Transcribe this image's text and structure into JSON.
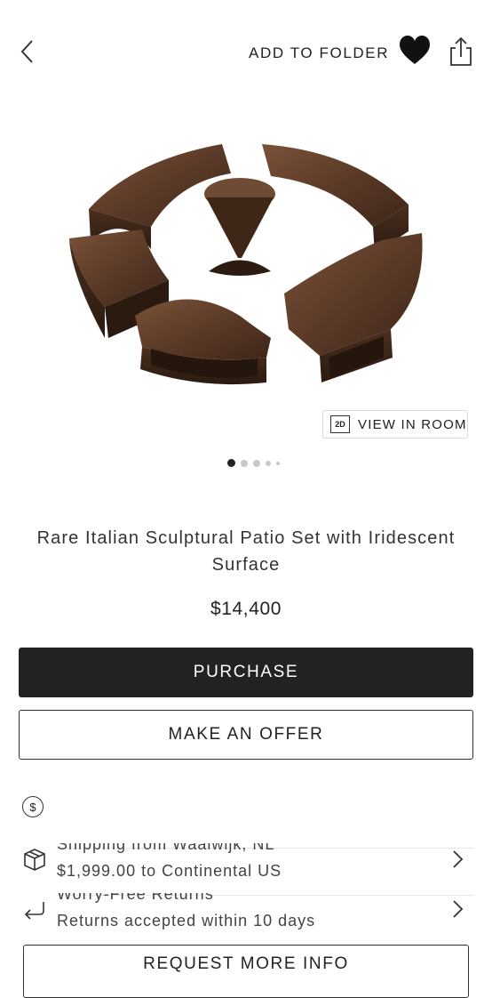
{
  "header": {
    "add_to_folder": "ADD TO FOLDER",
    "icons": [
      "back-chevron-icon",
      "heart-icon",
      "share-icon"
    ]
  },
  "product": {
    "view_in_room": {
      "badge": "2D",
      "label": "VIEW IN ROOM"
    },
    "carousel": {
      "count": 5,
      "active": 0
    },
    "title": "Rare Italian Sculptural Patio Set with Iridescent Surface",
    "price": "$14,400"
  },
  "actions": {
    "purchase": "PURCHASE",
    "make_offer": "MAKE AN OFFER",
    "request_info": "REQUEST MORE INFO"
  },
  "details": {
    "shipping": {
      "heading": "Shipping from Waalwijk, NL",
      "value": "$1,999.00 to Continental US"
    },
    "returns": {
      "heading": "Worry-Free Returns",
      "value": "Returns accepted within 10 days"
    }
  },
  "colors": {
    "primary_button": "#222222",
    "sculpture_bronze": "#5b3a27"
  }
}
